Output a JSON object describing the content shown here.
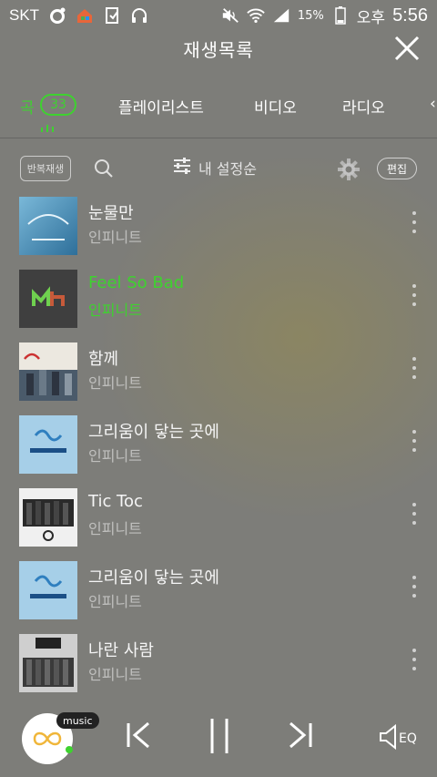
{
  "status_bar": {
    "carrier": "SKT",
    "battery_percent": "15%",
    "ampm": "오후",
    "time": "5:56",
    "icons": [
      "circle-icon",
      "home-launcher-icon",
      "file-icon",
      "headphones-icon",
      "mute-icon",
      "wifi-icon",
      "signal-icon",
      "battery-icon"
    ]
  },
  "header": {
    "title": "재생목록",
    "close_icon": "close-icon"
  },
  "tabs": [
    {
      "label": "곡",
      "count": "33",
      "active": true
    },
    {
      "label": "플레이리스트",
      "active": false
    },
    {
      "label": "비디오",
      "active": false
    },
    {
      "label": "라디오",
      "active": false
    }
  ],
  "toolbar": {
    "repeat_label": "반복재생",
    "sort_label": "내 설정순",
    "edit_label": "편집"
  },
  "songs": [
    {
      "title": "눈물만",
      "artist": "인피니트",
      "playing": false
    },
    {
      "title": "Feel So Bad",
      "artist": "인피니트",
      "playing": true
    },
    {
      "title": "함께",
      "artist": "인피니트",
      "playing": false
    },
    {
      "title": "그리움이 닿는 곳에",
      "artist": "인피니트",
      "playing": false
    },
    {
      "title": "Tic Toc",
      "artist": "인피니트",
      "playing": false
    },
    {
      "title": "그리움이 닿는 곳에",
      "artist": "인피니트",
      "playing": false
    },
    {
      "title": "나란 사람",
      "artist": "인피니트",
      "playing": false
    }
  ],
  "player": {
    "badge": "music",
    "eq_label": "EQ"
  },
  "colors": {
    "accent": "#3ed22f",
    "background": "#7d7d79"
  }
}
